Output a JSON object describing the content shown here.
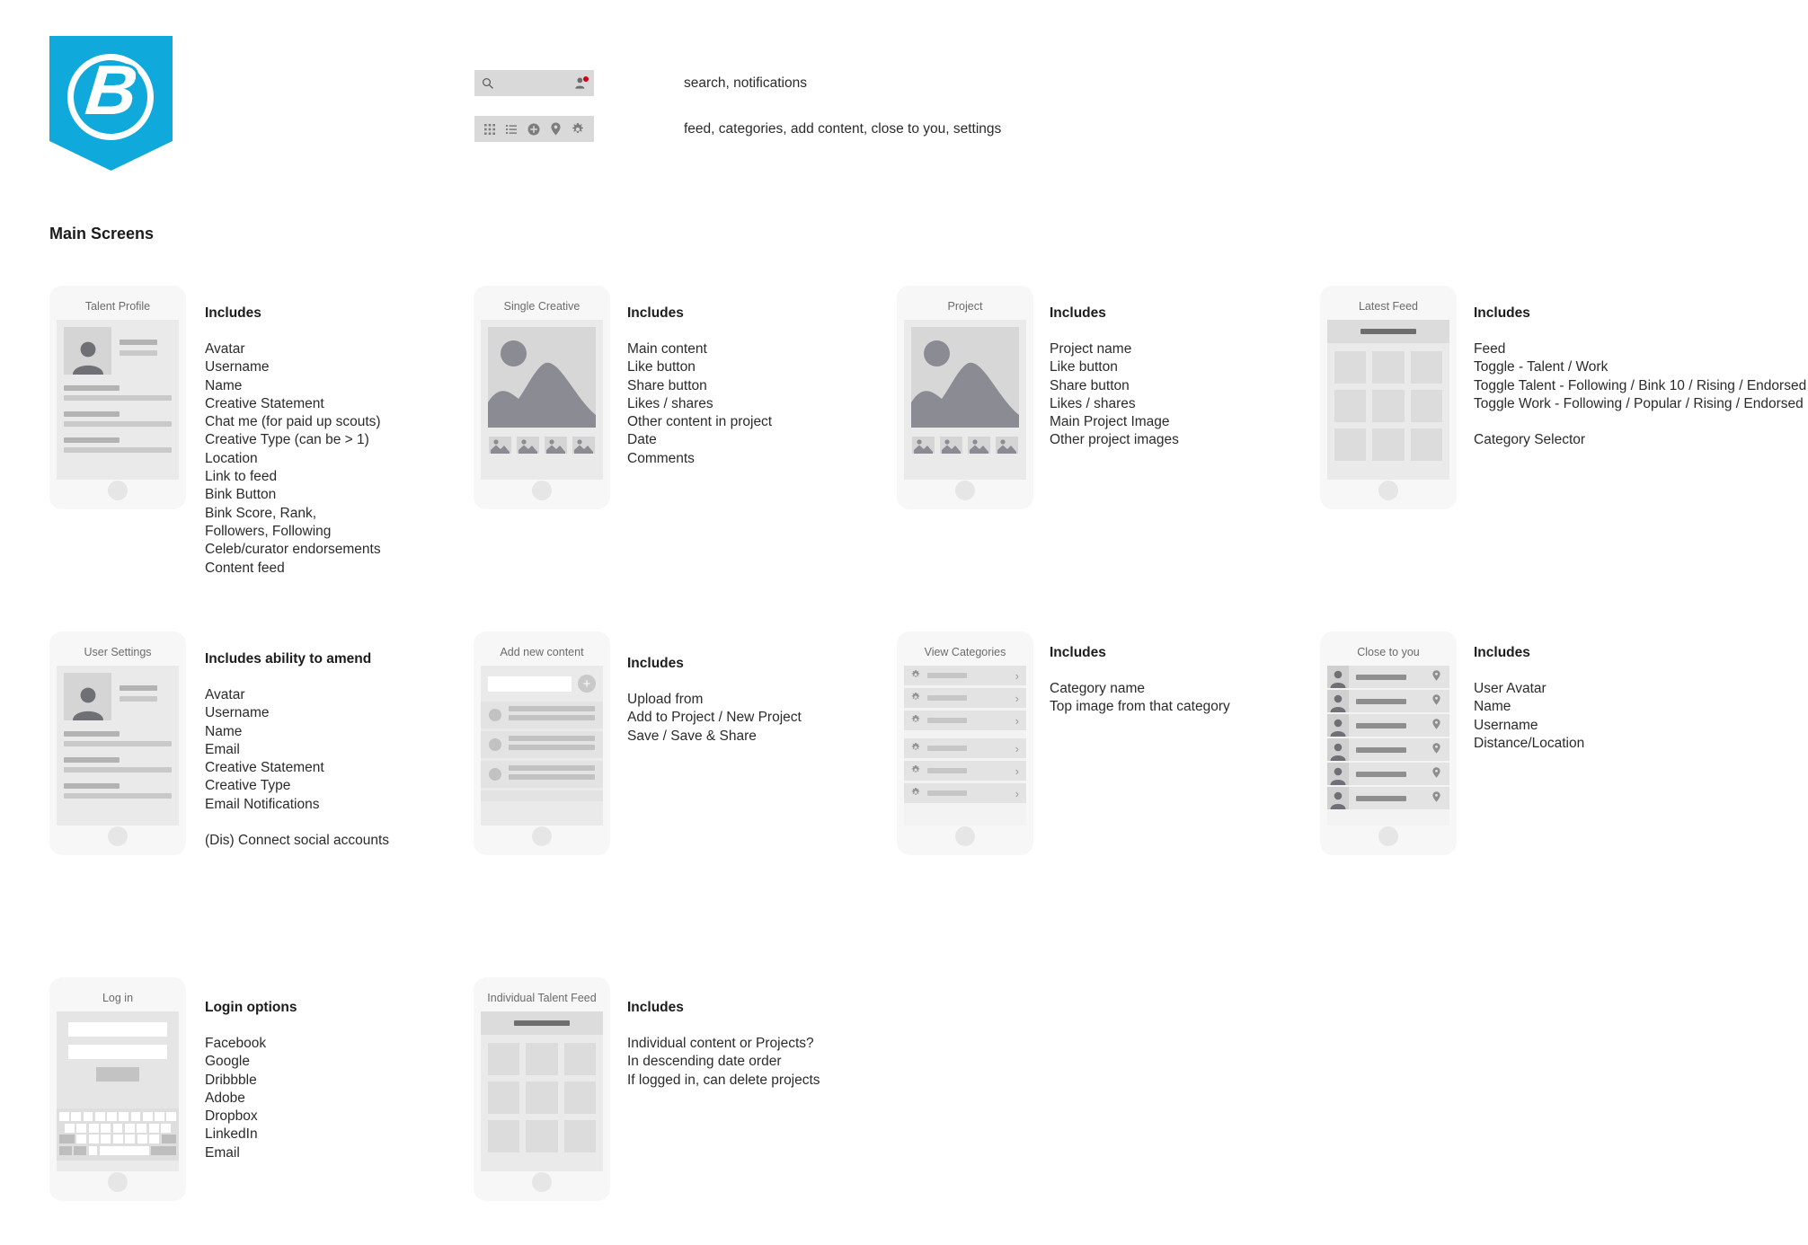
{
  "logo": {
    "letter": "B",
    "color": "#10A9DB"
  },
  "ui_bars": [
    {
      "id": "search-bar",
      "icons": [
        "search-icon",
        "person-notification-icon"
      ],
      "caption": "search, notifications"
    },
    {
      "id": "nav-bar",
      "icons": [
        "grid-icon",
        "list-icon",
        "plus-circle-icon",
        "location-pin-icon",
        "gear-icon"
      ],
      "caption": "feed, categories, add content, close to you, settings"
    }
  ],
  "section_title": "Main Screens",
  "screens": [
    {
      "key": "talent-profile",
      "phone_title": "Talent Profile",
      "includes_title": "Includes",
      "includes": [
        "Avatar",
        "Username",
        "Name",
        "Creative Statement",
        "Chat me (for paid up scouts)",
        "Creative Type (can be > 1)",
        "Location",
        "Link to feed",
        "Bink Button",
        "Bink Score, Rank,",
        "Followers, Following",
        "Celeb/curator endorsements",
        "Content feed"
      ]
    },
    {
      "key": "single-creative",
      "phone_title": "Single Creative",
      "includes_title": "Includes",
      "includes": [
        "Main content",
        "Like button",
        "Share button",
        "Likes / shares",
        "Other content in project",
        "Date",
        "Comments"
      ]
    },
    {
      "key": "project",
      "phone_title": "Project",
      "includes_title": "Includes",
      "includes": [
        "Project name",
        "Like button",
        "Share button",
        "Likes / shares",
        "Main Project Image",
        "Other project images"
      ]
    },
    {
      "key": "latest-feed",
      "phone_title": "Latest Feed",
      "includes_title": "Includes",
      "includes": [
        "Feed",
        "Toggle - Talent / Work",
        "Toggle Talent - Following / Bink 10 / Rising / Endorsed",
        "Toggle Work - Following / Popular / Rising / Endorsed"
      ],
      "includes_extra": [
        "Category Selector"
      ]
    },
    {
      "key": "user-settings",
      "phone_title": "User Settings",
      "includes_title": "Includes ability to amend",
      "includes": [
        "Avatar",
        "Username",
        "Name",
        "Email",
        "Creative Statement",
        "Creative Type",
        "Email Notifications"
      ],
      "includes_extra": [
        "(Dis) Connect social accounts"
      ]
    },
    {
      "key": "add-new-content",
      "phone_title": "Add new content",
      "includes_title": "Includes",
      "includes": [
        "Upload from",
        "Add to Project / New Project",
        "Save / Save & Share"
      ]
    },
    {
      "key": "view-categories",
      "phone_title": "View Categories",
      "includes_title": "Includes",
      "includes": [
        "Category name",
        "Top image from that category"
      ]
    },
    {
      "key": "close-to-you",
      "phone_title": "Close to you",
      "includes_title": "Includes",
      "includes": [
        "User Avatar",
        "Name",
        "Username",
        "Distance/Location"
      ]
    },
    {
      "key": "log-in",
      "phone_title": "Log in",
      "includes_title": "Login options",
      "includes": [
        "Facebook",
        "Google",
        "Dribbble",
        "Adobe",
        "Dropbox",
        "LinkedIn",
        "Email"
      ]
    },
    {
      "key": "individual-talent-feed",
      "phone_title": "Individual Talent Feed",
      "includes_title": "Includes",
      "includes": [
        "Individual content or Projects?",
        "In descending date order",
        "If logged in, can delete projects"
      ]
    }
  ]
}
